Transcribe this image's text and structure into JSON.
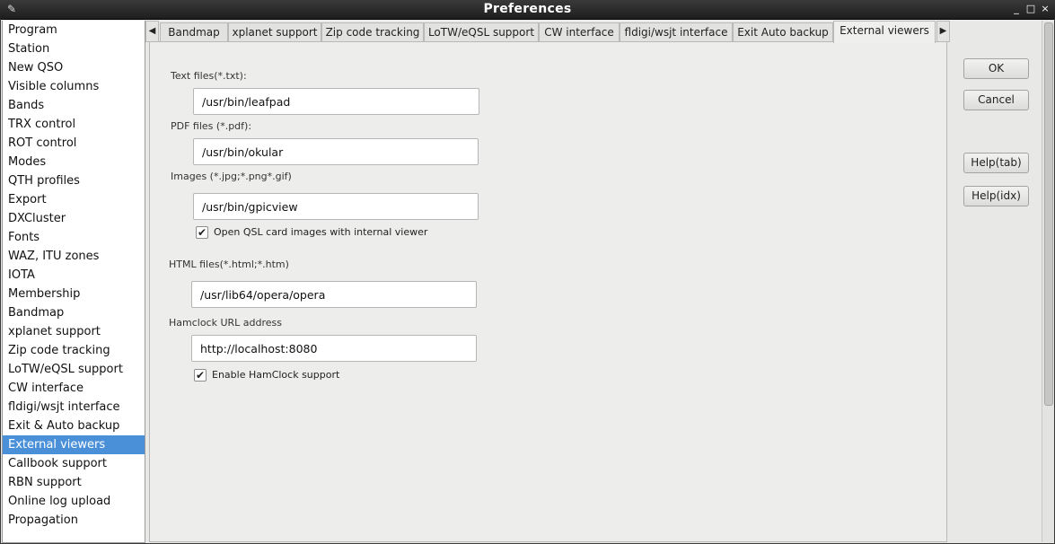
{
  "window": {
    "title": "Preferences",
    "app_icon": "app-feather-icon",
    "minimize_glyph": "_",
    "maximize_glyph": "□",
    "close_glyph": "×"
  },
  "nav": {
    "items": [
      "Program",
      "Station",
      "New QSO",
      "Visible columns",
      "Bands",
      "TRX control",
      "ROT control",
      "Modes",
      "QTH profiles",
      "Export",
      "DXCluster",
      "Fonts",
      "WAZ, ITU zones",
      "IOTA",
      "Membership",
      "Bandmap",
      "xplanet support",
      "Zip code tracking",
      "LoTW/eQSL support",
      "CW interface",
      "fldigi/wsjt interface",
      "Exit & Auto backup",
      "External viewers",
      "Callbook support",
      "RBN support",
      "Online log upload",
      "Propagation"
    ],
    "selected": "External viewers"
  },
  "tabs": {
    "left_arrow": "◀",
    "right_arrow": "▶",
    "items": [
      "Bandmap",
      "xplanet support",
      "Zip code tracking",
      "LoTW/eQSL support",
      "CW interface",
      "fldigi/wsjt interface",
      "Exit  Auto backup",
      "External viewers"
    ],
    "active": "External viewers"
  },
  "form": {
    "text_files_label": "Text files(*.txt):",
    "text_files_value": "/usr/bin/leafpad",
    "pdf_files_label": "PDF files (*.pdf):",
    "pdf_files_value": "/usr/bin/okular",
    "images_label": "Images (*.jpg;*.png*.gif)",
    "images_value": "/usr/bin/gpicview",
    "qsl_internal_label": "Open QSL card images with internal viewer",
    "qsl_internal_checked": true,
    "html_files_label": "HTML files(*.html;*.htm)",
    "html_files_value": "/usr/lib64/opera/opera",
    "hamclock_label": "Hamclock URL address",
    "hamclock_value": "http://localhost:8080",
    "hamclock_enable_label": "Enable HamClock support",
    "hamclock_enable_checked": true,
    "check_glyph": "✔"
  },
  "buttons": {
    "ok": "OK",
    "cancel": "Cancel",
    "help_tab": "Help(tab)",
    "help_idx": "Help(idx)"
  },
  "colors": {
    "selection": "#4a90d9",
    "titlebar": "#2a2a2a"
  }
}
